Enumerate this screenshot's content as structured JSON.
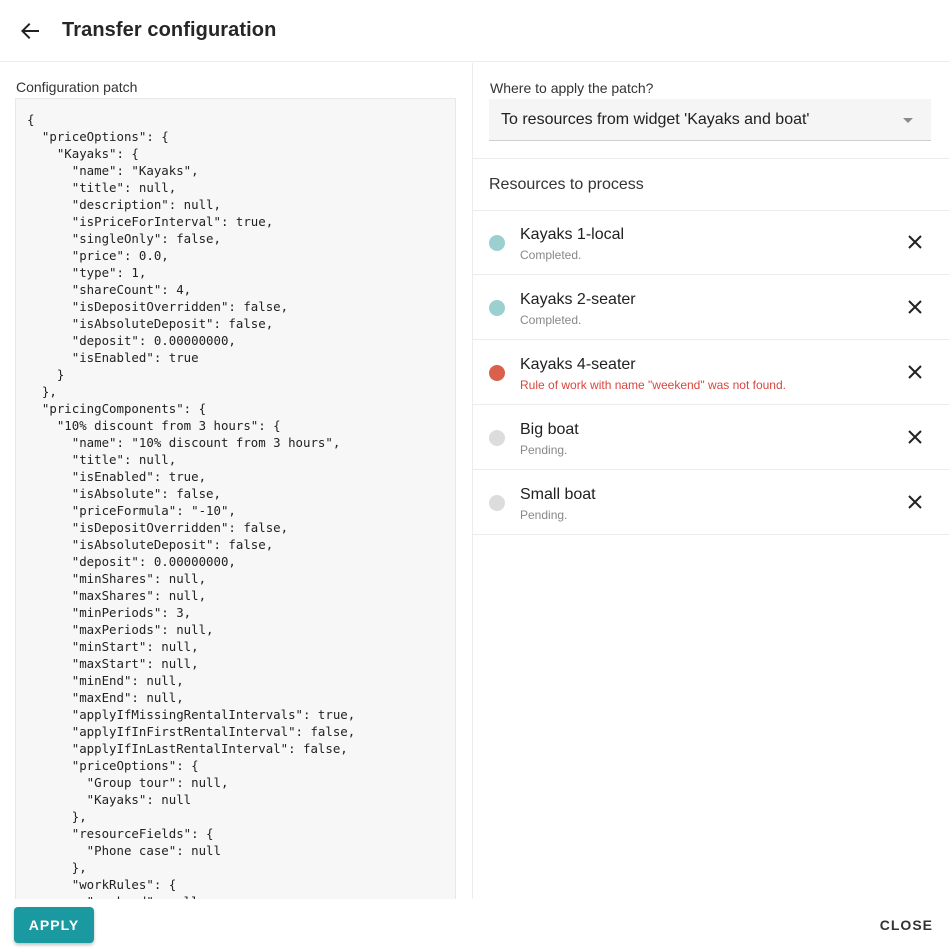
{
  "header": {
    "title": "Transfer configuration"
  },
  "config": {
    "label": "Configuration patch",
    "code": "{\n  \"priceOptions\": {\n    \"Kayaks\": {\n      \"name\": \"Kayaks\",\n      \"title\": null,\n      \"description\": null,\n      \"isPriceForInterval\": true,\n      \"singleOnly\": false,\n      \"price\": 0.0,\n      \"type\": 1,\n      \"shareCount\": 4,\n      \"isDepositOverridden\": false,\n      \"isAbsoluteDeposit\": false,\n      \"deposit\": 0.00000000,\n      \"isEnabled\": true\n    }\n  },\n  \"pricingComponents\": {\n    \"10% discount from 3 hours\": {\n      \"name\": \"10% discount from 3 hours\",\n      \"title\": null,\n      \"isEnabled\": true,\n      \"isAbsolute\": false,\n      \"priceFormula\": \"-10\",\n      \"isDepositOverridden\": false,\n      \"isAbsoluteDeposit\": false,\n      \"deposit\": 0.00000000,\n      \"minShares\": null,\n      \"maxShares\": null,\n      \"minPeriods\": 3,\n      \"maxPeriods\": null,\n      \"minStart\": null,\n      \"maxStart\": null,\n      \"minEnd\": null,\n      \"maxEnd\": null,\n      \"applyIfMissingRentalIntervals\": true,\n      \"applyIfInFirstRentalInterval\": false,\n      \"applyIfInLastRentalInterval\": false,\n      \"priceOptions\": {\n        \"Group tour\": null,\n        \"Kayaks\": null\n      },\n      \"resourceFields\": {\n        \"Phone case\": null\n      },\n      \"workRules\": {\n        \"weekend\": null"
  },
  "target": {
    "label": "Where to apply the patch?",
    "selected": "To resources from widget 'Kayaks and boat'"
  },
  "resources": {
    "header": "Resources to process",
    "items": [
      {
        "name": "Kayaks 1-local",
        "status": "Completed.",
        "state": "completed",
        "color": "#9ccfcf"
      },
      {
        "name": "Kayaks 2-seater",
        "status": "Completed.",
        "state": "completed",
        "color": "#9ccfcf"
      },
      {
        "name": "Kayaks 4-seater",
        "status": "Rule of work with name \"weekend\" was not found.",
        "state": "error",
        "color": "#d9604c"
      },
      {
        "name": "Big boat",
        "status": "Pending.",
        "state": "pending",
        "color": "#dcdcdc"
      },
      {
        "name": "Small boat",
        "status": "Pending.",
        "state": "pending",
        "color": "#dcdcdc"
      }
    ]
  },
  "footer": {
    "apply_label": "APPLY",
    "close_label": "CLOSE",
    "accent": "#1a9aa0"
  }
}
